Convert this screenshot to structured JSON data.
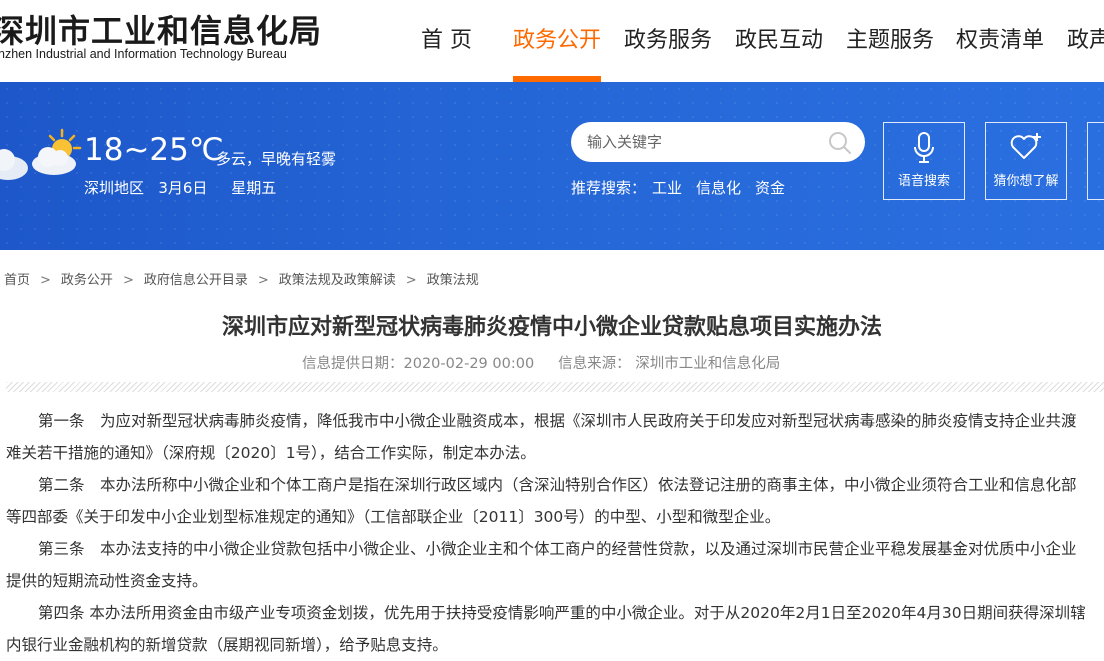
{
  "header": {
    "logo_cn": "深圳市工业和信息化局",
    "logo_en": "nzhen Industrial and Information Technology Bureau",
    "nav": [
      "首 页",
      "政务公开",
      "政务服务",
      "政民互动",
      "主题服务",
      "权责清单",
      "政声"
    ],
    "active_nav": "政务公开",
    "accent_color": "#ff6a00"
  },
  "weather": {
    "temp": "18~25℃",
    "desc": "多云，早晚有轻雾",
    "location": "深圳地区",
    "date": "3月6日",
    "weekday": "星期五",
    "icon": "cloudy-sun-icon"
  },
  "search": {
    "placeholder": "输入关键字",
    "rec_label": "推荐搜索：",
    "rec_links": [
      "工业",
      "信息化",
      "资金"
    ]
  },
  "tiles": {
    "voice": "语音搜索",
    "guess": "猜你想了解"
  },
  "breadcrumb": [
    "首页",
    "政务公开",
    "政府信息公开目录",
    "政策法规及政策解读",
    "政策法规"
  ],
  "article": {
    "title": "深圳市应对新型冠状病毒肺炎疫情中小微企业贷款贴息项目实施办法",
    "date_label": "信息提供日期：",
    "date": "2020-02-29 00:00",
    "source_label": "信息来源：",
    "source": "深圳市工业和信息化局",
    "lines": [
      "第一条　为应对新型冠状病毒肺炎疫情，降低我市中小微企业融资成本，根据《深圳市人民政府关于印发应对新型冠状病毒感染的肺炎疫情支持企业共渡",
      "难关若干措施的通知》（深府规〔2020〕1号），结合工作实际，制定本办法。",
      "第二条　本办法所称中小微企业和个体工商户是指在深圳行政区域内（含深汕特别合作区）依法登记注册的商事主体，中小微企业须符合工业和信息化部",
      "等四部委《关于印发中小企业划型标准规定的通知》（工信部联企业〔2011〕300号）的中型、小型和微型企业。",
      "第三条　本办法支持的中小微企业贷款包括中小微企业、小微企业主和个体工商户的经营性贷款，以及通过深圳市民营企业平稳发展基金对优质中小企业",
      "提供的短期流动性资金支持。",
      "第四条 本办法所用资金由市级产业专项资金划拨，优先用于扶持受疫情影响严重的中小微企业。对于从2020年2月1日至2020年4月30日期间获得深圳辖",
      "内银行业金融机构的新增贷款（展期视同新增），给予贴息支持。"
    ]
  }
}
